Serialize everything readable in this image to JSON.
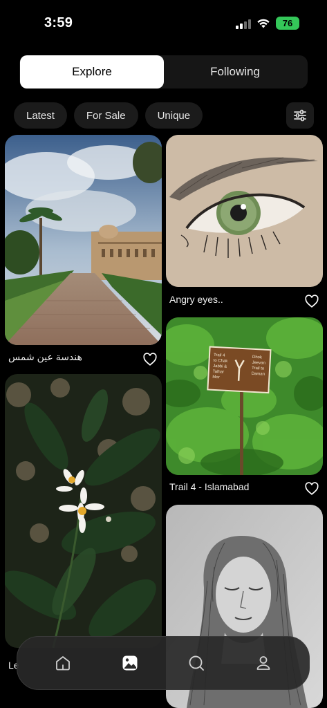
{
  "status": {
    "time": "3:59",
    "battery": "76"
  },
  "tabs": [
    {
      "label": "Explore",
      "active": true
    },
    {
      "label": "Following",
      "active": false
    }
  ],
  "chips": [
    {
      "label": "Latest"
    },
    {
      "label": "For Sale"
    },
    {
      "label": "Unique"
    }
  ],
  "posts": [
    {
      "caption": "هندسة عين شمس",
      "liked": false
    },
    {
      "caption": "Angry eyes..",
      "liked": false
    },
    {
      "caption": "Trail 4 - Islamabad",
      "liked": false
    },
    {
      "caption": "Le",
      "liked": false
    }
  ],
  "trail_sign": {
    "line1": "Trail 4",
    "line2": "to Chak",
    "line3": "Jabbi &",
    "line4": "Talhar",
    "line5": "Mor",
    "right1": "Dhok",
    "right2": "Jeevan",
    "right3": "Trail to",
    "right4": "Daman"
  },
  "nav": {
    "items": [
      {
        "icon": "home-icon",
        "active": false
      },
      {
        "icon": "gallery-icon",
        "active": true
      },
      {
        "icon": "search-icon",
        "active": false
      },
      {
        "icon": "profile-icon",
        "active": false
      }
    ]
  },
  "colors": {
    "background": "#000000",
    "active_tab": "#ffffff",
    "battery": "#34c759",
    "chip": "#1b1b1b"
  }
}
